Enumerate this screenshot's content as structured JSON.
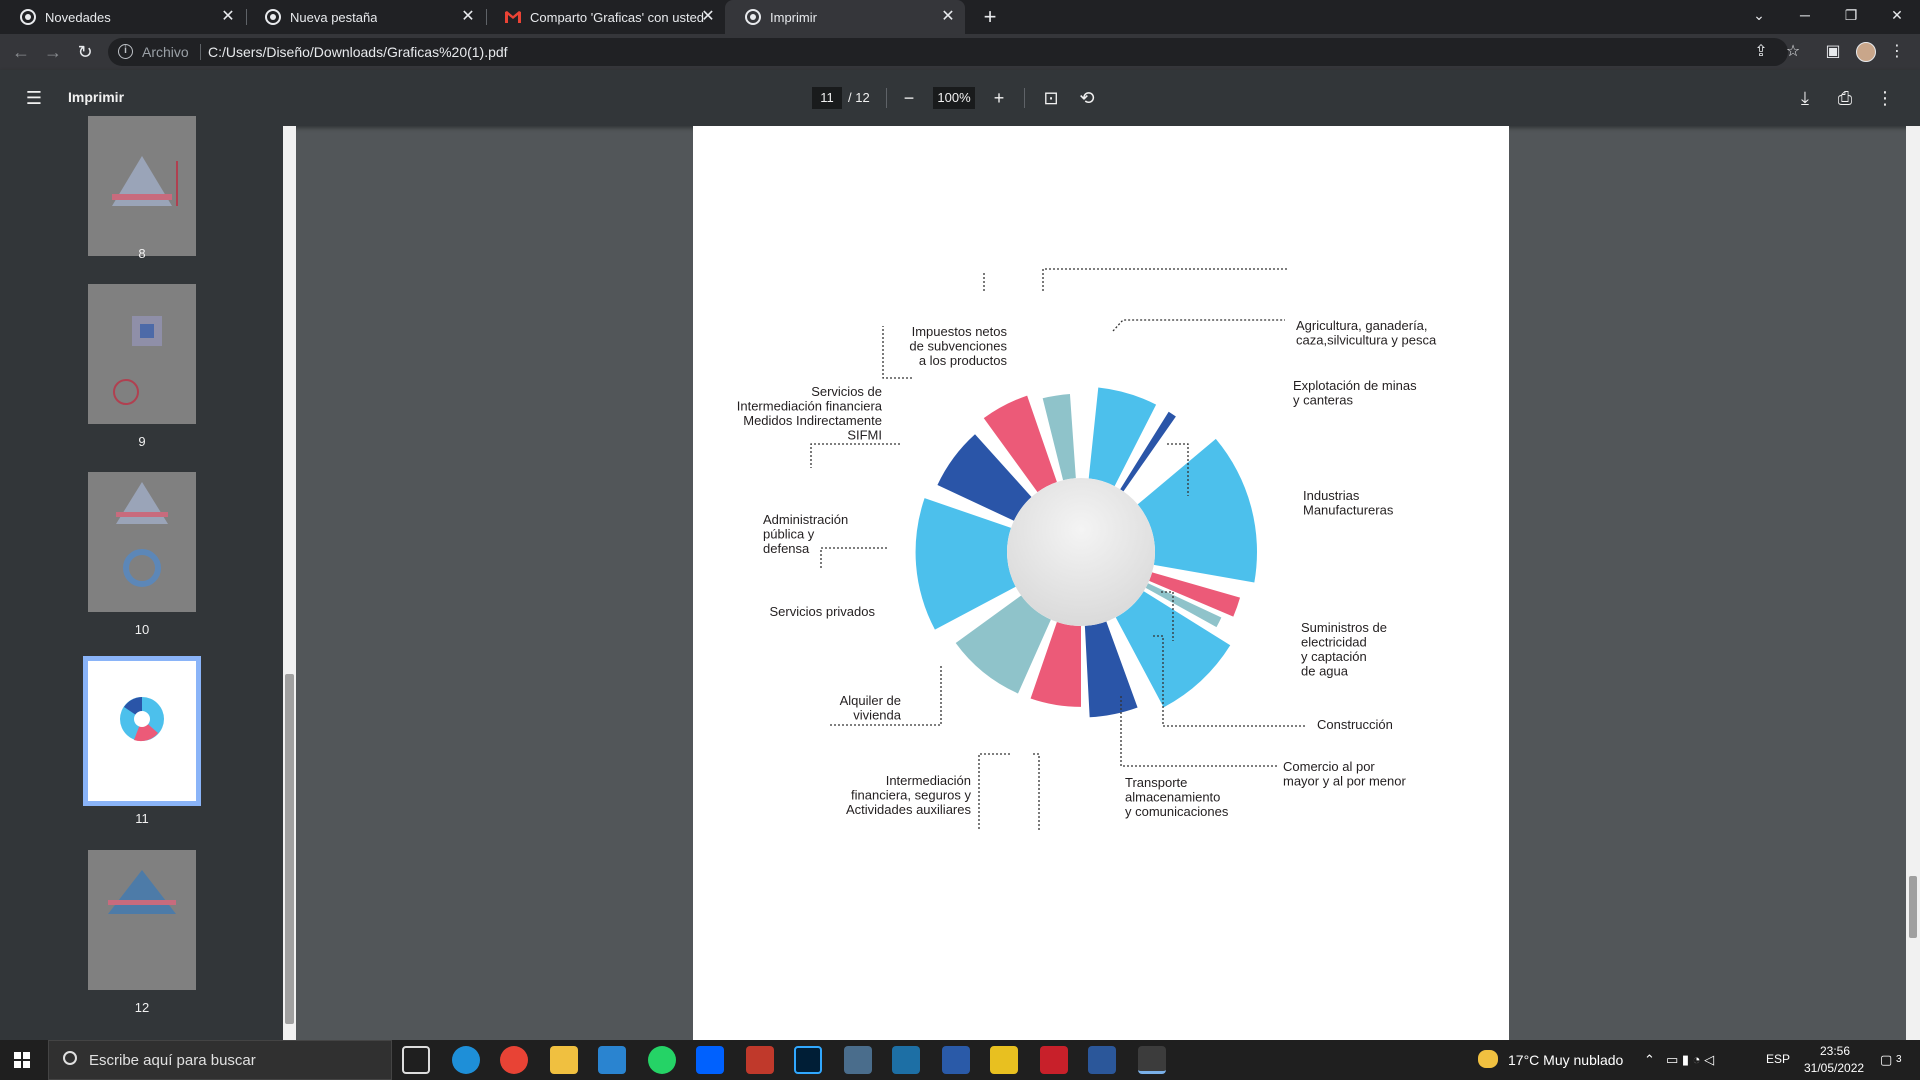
{
  "browser": {
    "tabs": [
      {
        "title": "Novedades"
      },
      {
        "title": "Nueva pestaña"
      },
      {
        "title": "Comparto 'Graficas' con usted - "
      },
      {
        "title": "Imprimir"
      }
    ],
    "address": {
      "scheme": "Archivo",
      "url": "C:/Users/Diseño/Downloads/Graficas%20(1).pdf"
    }
  },
  "pdf_toolbar": {
    "title": "Imprimir",
    "page_current": "11",
    "page_total": "/ 12",
    "zoom": "100%"
  },
  "sidebar": {
    "thumbnails": [
      {
        "label": "8"
      },
      {
        "label": "9"
      },
      {
        "label": "10"
      },
      {
        "label": "11"
      },
      {
        "label": "12"
      }
    ]
  },
  "chart_data": {
    "type": "pie",
    "title": "",
    "values_shown": false,
    "categories": [
      "Agricultura, ganadería, caza,silvicultura y pesca",
      "Explotación de minas y canteras",
      "Industrias Manufactureras",
      "Suministros de electricidad y captación de agua",
      "Construcción",
      "Comercio al por mayor y al por menor",
      "Transporte almacenamiento y comunicaciones",
      "Intermediación financiera, seguros y Actividades auxiliares",
      "Alquiler de vivienda",
      "Servicios privados",
      "Administración pública y defensa",
      "Servicios de Intermediación financiera Medidos Indirectamente SIFMI",
      "Impuestos netos de subvenciones a los productos"
    ],
    "colors": [
      "#4cc0ec",
      "#2a55a8",
      "#4cc0ec",
      "#ec5a78",
      "#8fc3ca",
      "#4cc0ec",
      "#2a55a8",
      "#ec5a78",
      "#8fc3ca",
      "#4cc0ec",
      "#2a55a8",
      "#ec5a78",
      "#8fc3ca"
    ],
    "start_angle_deg": [
      6,
      32,
      50,
      106,
      115,
      122,
      160,
      180,
      204,
      242,
      295,
      324,
      346
    ],
    "end_angle_deg": [
      27,
      35,
      100,
      113,
      119,
      152,
      177,
      199,
      234,
      289,
      318,
      341,
      356
    ],
    "radial_extent": [
      0.94,
      0.94,
      1.0,
      0.94,
      0.88,
      1.0,
      0.94,
      0.88,
      0.88,
      0.94,
      0.9,
      0.94,
      0.9
    ],
    "labels": [
      {
        "lines": [
          "Agricultura, ganadería,",
          "caza,silvicultura y pesca"
        ]
      },
      {
        "lines": [
          "Explotación de minas",
          "y canteras"
        ]
      },
      {
        "lines": [
          "Industrias",
          "Manufactureras"
        ]
      },
      {
        "lines": [
          "Suministros de",
          "electricidad",
          "y captación",
          "de agua"
        ]
      },
      {
        "lines": [
          "Construcción"
        ]
      },
      {
        "lines": [
          "Comercio al por",
          "mayor y al por menor"
        ]
      },
      {
        "lines": [
          "Transporte",
          "almacenamiento",
          "y comunicaciones"
        ]
      },
      {
        "lines": [
          "Intermediación",
          "financiera, seguros y",
          "Actividades auxiliares"
        ]
      },
      {
        "lines": [
          "Alquiler de",
          "vivienda"
        ]
      },
      {
        "lines": [
          "Servicios privados"
        ]
      },
      {
        "lines": [
          "Administración",
          "pública y",
          "defensa"
        ]
      },
      {
        "lines": [
          "Servicios de",
          "Intermediación financiera",
          "Medidos Indirectamente",
          "SIFMI"
        ]
      },
      {
        "lines": [
          "Impuestos netos",
          "de subvenciones",
          "a los productos"
        ]
      }
    ]
  },
  "taskbar": {
    "search_placeholder": "Escribe aquí para buscar",
    "weather": "17°C  Muy nublado",
    "language": "ESP",
    "time": "23:56",
    "date": "31/05/2022",
    "notifications": "3"
  }
}
